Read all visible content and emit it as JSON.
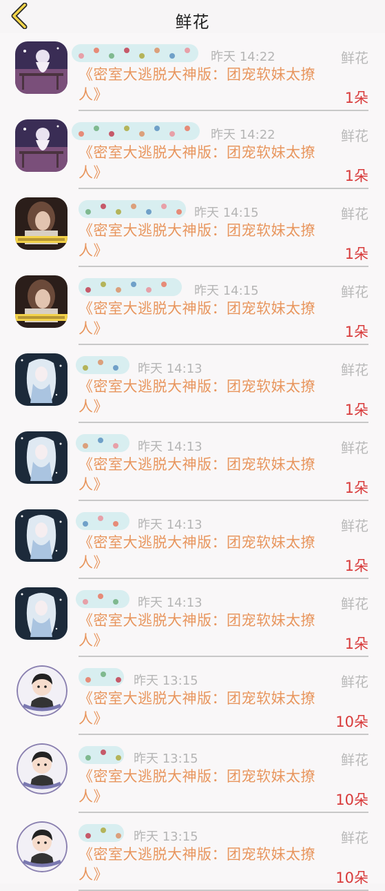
{
  "header": {
    "title": "鲜花"
  },
  "colors": {
    "book": "#e8965e",
    "count": "#d83a3a",
    "muted": "#b5b5b5"
  },
  "rows": [
    {
      "avatar": "night-scene-avatar",
      "time": "昨天 14:22",
      "type": "鲜花",
      "book": "《密室大逃脱大神版：团宠软妹太撩人》",
      "count": "1朵"
    },
    {
      "avatar": "night-scene-avatar",
      "time": "昨天 14:22",
      "type": "鲜花",
      "book": "《密室大逃脱大神版：团宠软妹太撩人》",
      "count": "1朵"
    },
    {
      "avatar": "girl-photo-avatar",
      "time": "昨天 14:15",
      "type": "鲜花",
      "book": "《密室大逃脱大神版：团宠软妹太撩人》",
      "count": "1朵"
    },
    {
      "avatar": "girl-photo-avatar",
      "time": "昨天 14:15",
      "type": "鲜花",
      "book": "《密室大逃脱大神版：团宠软妹太撩人》",
      "count": "1朵"
    },
    {
      "avatar": "anime-white-hair-avatar",
      "time": "昨天 14:13",
      "type": "鲜花",
      "book": "《密室大逃脱大神版：团宠软妹太撩人》",
      "count": "1朵"
    },
    {
      "avatar": "anime-white-hair-avatar",
      "time": "昨天 14:13",
      "type": "鲜花",
      "book": "《密室大逃脱大神版：团宠软妹太撩人》",
      "count": "1朵"
    },
    {
      "avatar": "anime-white-hair-avatar",
      "time": "昨天 14:13",
      "type": "鲜花",
      "book": "《密室大逃脱大神版：团宠软妹太撩人》",
      "count": "1朵"
    },
    {
      "avatar": "anime-white-hair-avatar",
      "time": "昨天 14:13",
      "type": "鲜花",
      "book": "《密室大逃脱大神版：团宠软妹太撩人》",
      "count": "1朵"
    },
    {
      "avatar": "cartoon-boy-avatar",
      "time": "昨天 13:15",
      "type": "鲜花",
      "book": "《密室大逃脱大神版：团宠软妹太撩人》",
      "count": "10朵"
    },
    {
      "avatar": "cartoon-boy-avatar",
      "time": "昨天 13:15",
      "type": "鲜花",
      "book": "《密室大逃脱大神版：团宠软妹太撩人》",
      "count": "10朵"
    },
    {
      "avatar": "cartoon-boy-avatar",
      "time": "昨天 13:15",
      "type": "鲜花",
      "book": "《密室大逃脱大神版：团宠软妹太撩人》",
      "count": "10朵"
    }
  ]
}
